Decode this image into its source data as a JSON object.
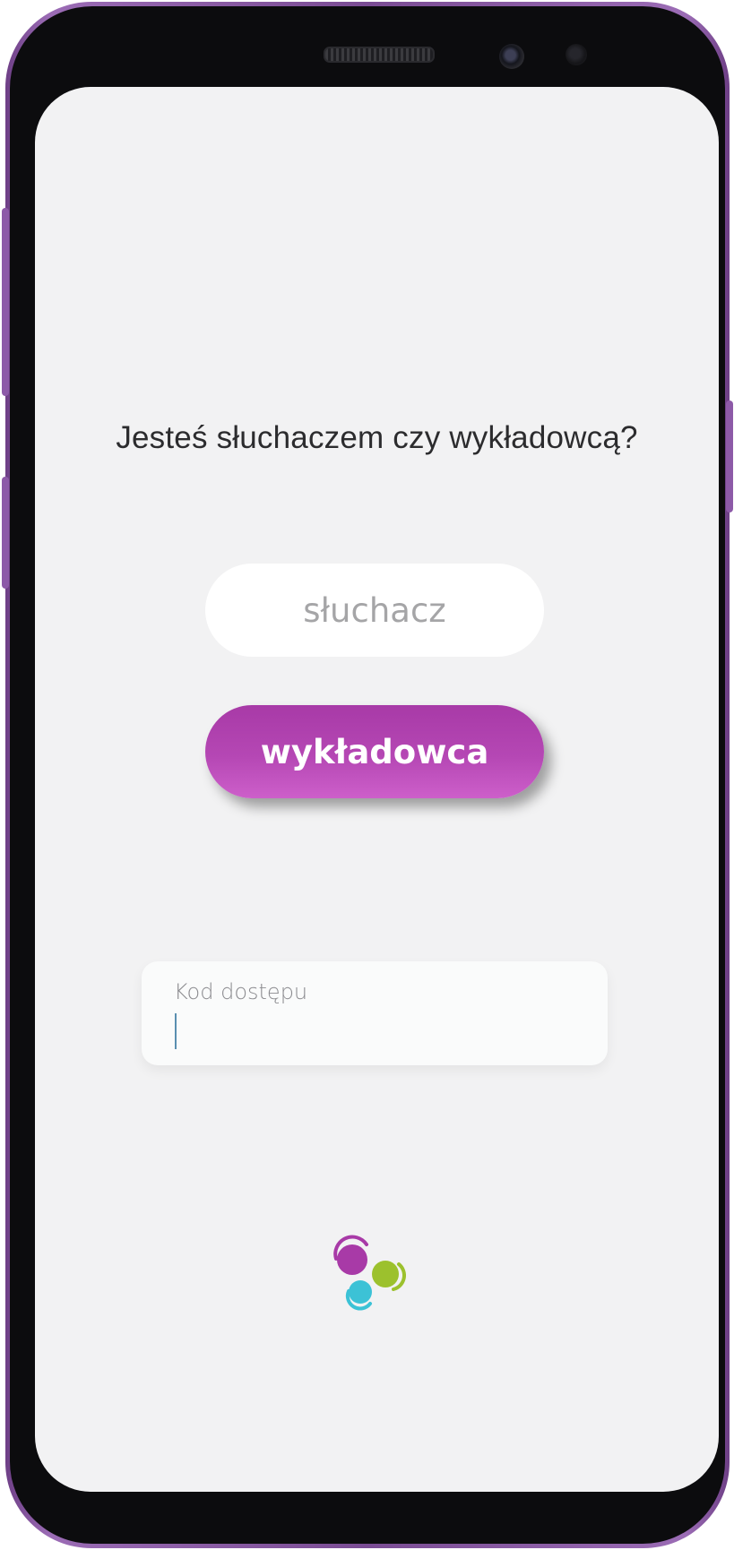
{
  "screen": {
    "question": "Jesteś słuchaczem czy wykładowcą?",
    "role_buttons": {
      "listener_label": "słuchacz",
      "lecturer_label": "wykładowca",
      "selected": "wykładowca"
    },
    "access_code": {
      "label": "Kod dostępu",
      "value": ""
    }
  },
  "colors": {
    "accent_purple": "#b547b4",
    "screen_background": "#f2f2f3",
    "logo_purple": "#a83aa7",
    "logo_green": "#9cc12d",
    "logo_cyan": "#3cc2d6"
  },
  "icons": {
    "logo": "three-dots-logo"
  }
}
